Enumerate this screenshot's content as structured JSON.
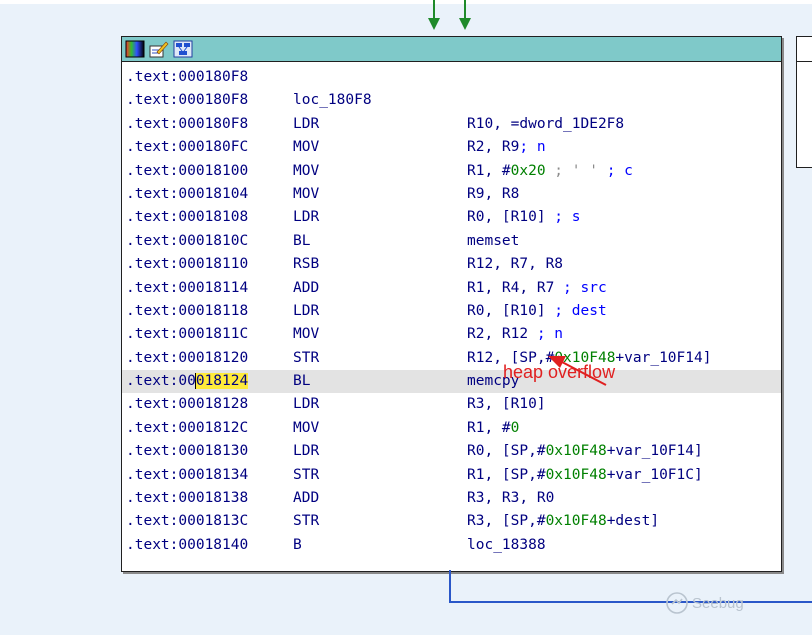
{
  "colors": {
    "background": "#eaf2fa",
    "node_title": "#7fc9c9",
    "address": "#000080",
    "number": "#008000",
    "comment": "#0000ff",
    "annotation": "#e02020",
    "edge_green": "#1f8a2a",
    "edge_blue": "#2a57c8",
    "highlight": "#ffeb3b"
  },
  "node": {
    "toolbar_icons": [
      "node-color-icon",
      "node-rename-icon",
      "node-graph-icon"
    ],
    "lines": [
      {
        "addr": ".text:000180F8",
        "mnem": "",
        "label": ""
      },
      {
        "addr": ".text:000180F8",
        "mnem": "",
        "label": "loc_180F8"
      },
      {
        "addr": ".text:000180F8",
        "mnem": "LDR",
        "op": "R10, =dword_1DE2F8"
      },
      {
        "addr": ".text:000180FC",
        "mnem": "MOV",
        "op": "R2, R9",
        "cmt": "; n"
      },
      {
        "addr": ".text:00018100",
        "mnem": "MOV",
        "op": "R1, #",
        "num": "0x20",
        "cmt_grey": " ; ' '",
        "cmt": " ; c"
      },
      {
        "addr": ".text:00018104",
        "mnem": "MOV",
        "op": "R9, R8"
      },
      {
        "addr": ".text:00018108",
        "mnem": "LDR",
        "op": "R0, [R10]",
        "cmt": " ; s"
      },
      {
        "addr": ".text:0001810C",
        "mnem": "BL",
        "op": "memset"
      },
      {
        "addr": ".text:00018110",
        "mnem": "RSB",
        "op": "R12, R7, R8"
      },
      {
        "addr": ".text:00018114",
        "mnem": "ADD",
        "op": "R1, R4, R7",
        "cmt": " ; src"
      },
      {
        "addr": ".text:00018118",
        "mnem": "LDR",
        "op": "R0, [R10]",
        "cmt": " ; dest"
      },
      {
        "addr": ".text:0001811C",
        "mnem": "MOV",
        "op": "R2, R12",
        "cmt": " ; n"
      },
      {
        "addr": ".text:00018120",
        "mnem": "STR",
        "op": "R12, [SP,#",
        "num": "0x10F48",
        "op2": "+var_10F14]"
      },
      {
        "addr_pre": ".text:00",
        "addr_hl": "018124",
        "mnem": "BL",
        "op": "memcpy",
        "current": true
      },
      {
        "addr": ".text:00018128",
        "mnem": "LDR",
        "op": "R3, [R10]"
      },
      {
        "addr": ".text:0001812C",
        "mnem": "MOV",
        "op": "R1, #",
        "num": "0"
      },
      {
        "addr": ".text:00018130",
        "mnem": "LDR",
        "op": "R0, [SP,#",
        "num": "0x10F48",
        "op2": "+var_10F14]"
      },
      {
        "addr": ".text:00018134",
        "mnem": "STR",
        "op": "R1, [SP,#",
        "num": "0x10F48",
        "op2": "+var_10F1C]"
      },
      {
        "addr": ".text:00018138",
        "mnem": "ADD",
        "op": "R3, R3, R0"
      },
      {
        "addr": ".text:0001813C",
        "mnem": "STR",
        "op": "R3, [SP,#",
        "num": "0x10F48",
        "op2": "+dest]"
      },
      {
        "addr": ".text:00018140",
        "mnem": "B",
        "op": "loc_18388"
      }
    ]
  },
  "annotation": {
    "text": "heap overflow"
  },
  "watermark": {
    "text": "Seebug"
  }
}
